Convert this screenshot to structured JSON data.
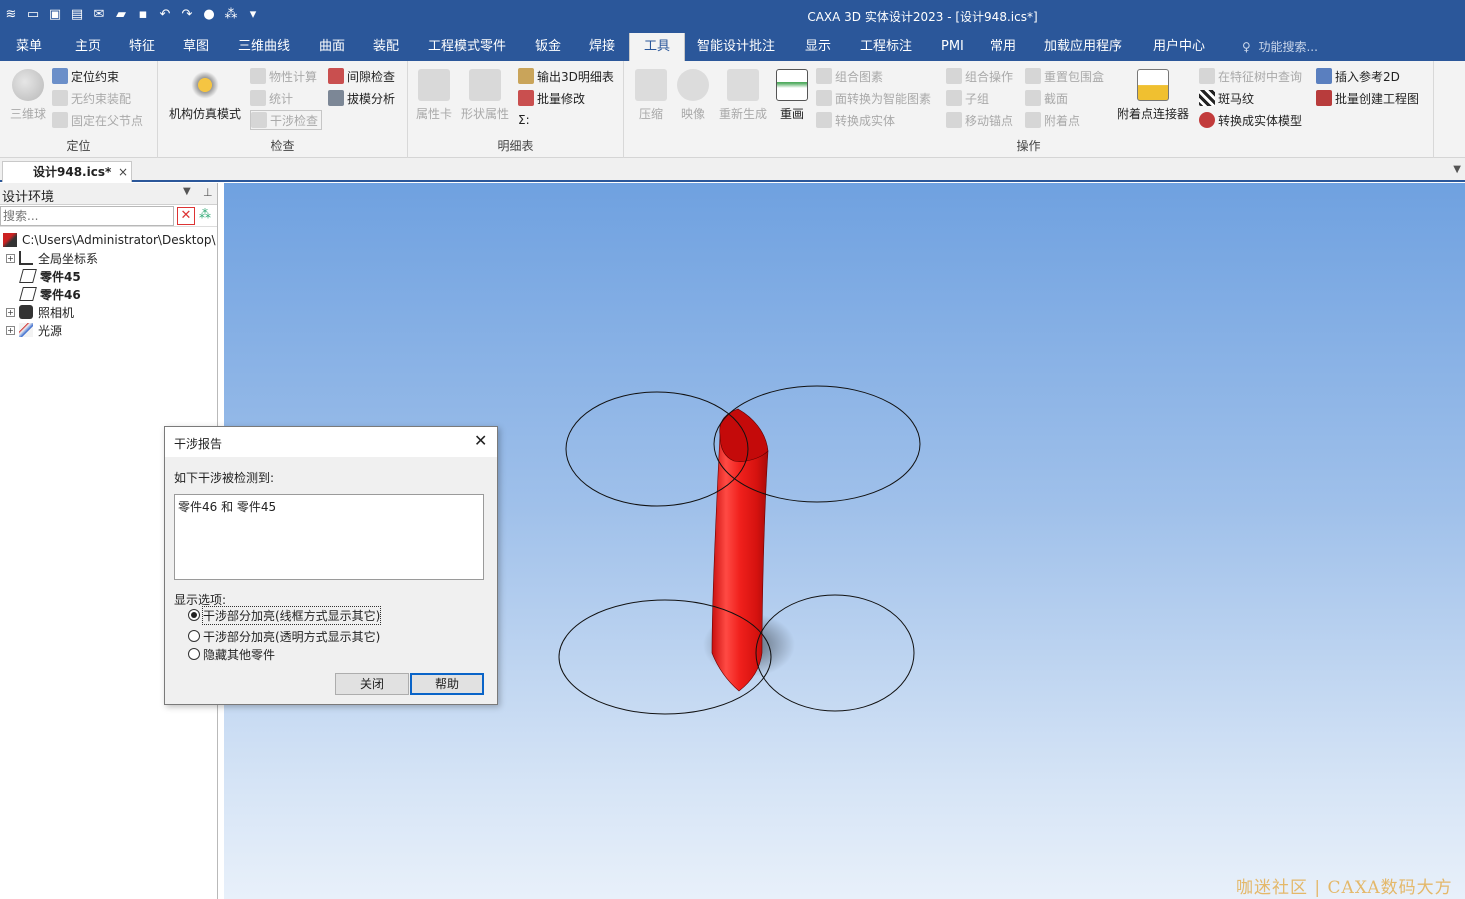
{
  "app": {
    "title": "CAXA 3D 实体设计2023 - [设计948.ics*]"
  },
  "menu": {
    "tabs": [
      "菜单",
      "主页",
      "特征",
      "草图",
      "三维曲线",
      "曲面",
      "装配",
      "工程模式零件",
      "钣金",
      "焊接",
      "工具",
      "智能设计批注",
      "显示",
      "工程标注",
      "PMI",
      "常用",
      "加载应用程序",
      "用户中心"
    ],
    "active_tab": "工具",
    "search_placeholder": "功能搜索..."
  },
  "ribbon": {
    "groups": {
      "locate": {
        "label": "定位",
        "big_button": "三维球",
        "items": [
          "定位约束",
          "无约束装配",
          "固定在父节点"
        ]
      },
      "inspect": {
        "label": "检查",
        "big_button": "机构仿真模式",
        "items": [
          "物性计算",
          "统计",
          "干涉检查",
          "间隙检查",
          "拔模分析"
        ]
      },
      "bom": {
        "label": "明细表",
        "big_buttons": [
          "属性卡",
          "形状属性"
        ],
        "items": [
          "输出3D明细表",
          "批量修改",
          "Σ:"
        ]
      },
      "operate": {
        "label": "操作",
        "big_buttons": [
          "压缩",
          "映像",
          "重新生成",
          "重画"
        ],
        "items": [
          "组合图素",
          "面转换为智能图素",
          "转换成实体",
          "组合操作",
          "子组",
          "移动锚点",
          "重置包围盒",
          "截面",
          "附着点"
        ],
        "attach_button": "附着点连接器",
        "right_items": [
          "在特征树中查询",
          "斑马纹",
          "转换成实体模型",
          "插入参考2D",
          "批量创建工程图"
        ]
      }
    }
  },
  "doc_tab": {
    "label": "设计948.ics*",
    "close": "×"
  },
  "left_panel": {
    "title": "设计环境",
    "search_placeholder": "搜索...",
    "tree": [
      {
        "label": "C:\\Users\\Administrator\\Desktop\\",
        "bold": false
      },
      {
        "label": "全局坐标系",
        "bold": false
      },
      {
        "label": "零件45",
        "bold": true
      },
      {
        "label": "零件46",
        "bold": true
      },
      {
        "label": "照相机",
        "bold": false
      },
      {
        "label": "光源",
        "bold": false
      }
    ]
  },
  "dialog": {
    "title": "干涉报告",
    "detected_label": "如下干涉被检测到:",
    "results": [
      "零件46 和 零件45"
    ],
    "display_label": "显示选项:",
    "options": [
      "干涉部分加亮(线框方式显示其它)",
      "干涉部分加亮(透明方式显示其它)",
      "隐藏其他零件"
    ],
    "selected_option": 0,
    "close_button": "关闭",
    "help_button": "帮助"
  },
  "watermark": "咖迷社区 | CAXA数码大方",
  "colors": {
    "accent": "#2b579a",
    "interference": "#e8201c"
  }
}
